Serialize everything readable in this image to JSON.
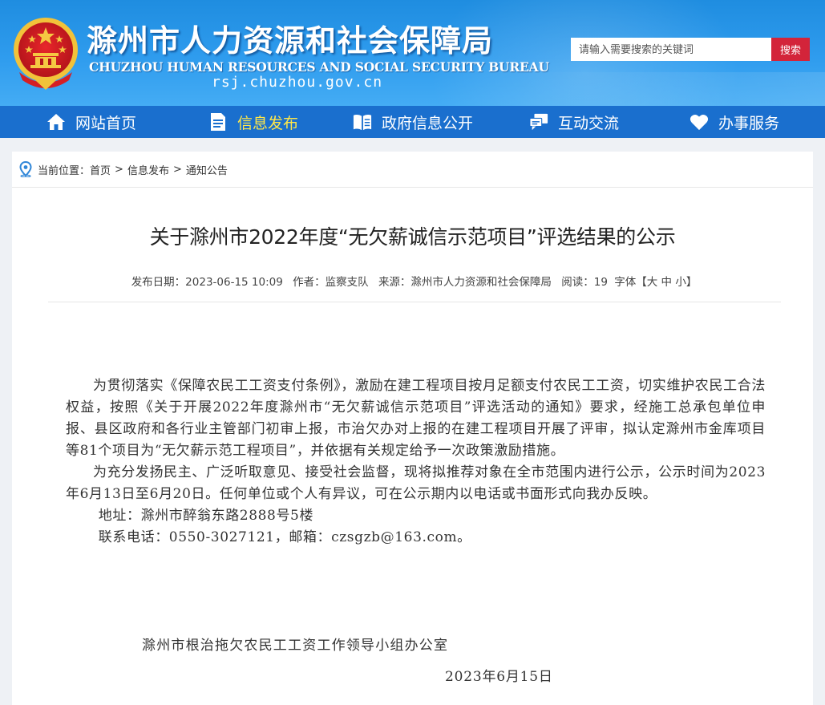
{
  "header": {
    "title": "滁州市人力资源和社会保障局",
    "subtitle": "CHUZHOU HUMAN RESOURCES AND SOCIAL SECURITY BUREAU",
    "domain": "rsj.chuzhou.gov.cn",
    "search_placeholder": "请输入需要搜索的关键词",
    "search_button": "搜索",
    "emblem_icon": "national-emblem-icon"
  },
  "nav": {
    "items": [
      {
        "label": "网站首页",
        "icon": "home-icon",
        "active": false
      },
      {
        "label": "信息发布",
        "icon": "document-icon",
        "active": true
      },
      {
        "label": "政府信息公开",
        "icon": "book-icon",
        "active": false
      },
      {
        "label": "互动交流",
        "icon": "chat-icon",
        "active": false
      },
      {
        "label": "办事服务",
        "icon": "heart-hand-icon",
        "active": false
      }
    ]
  },
  "breadcrumb": {
    "prefix": "当前位置：",
    "items": [
      "首页",
      "信息发布",
      "通知公告"
    ],
    "separator": ">"
  },
  "article": {
    "title": "关于滁州市2022年度“无欠薪诚信示范项目”评选结果的公示",
    "meta": {
      "date": "发布日期：2023-06-15 10:09",
      "author": "作者：监察支队",
      "source": "来源：滁州市人力资源和社会保障局",
      "views": "阅读：19",
      "fontsize_label": "字体【",
      "font_large": "大",
      "font_medium": "中",
      "font_small": "小",
      "fontsize_end": "】"
    },
    "paragraphs": [
      "为贯彻落实《保障农民工工资支付条例》，激励在建工程项目按月足额支付农民工工资，切实维护农民工合法权益，按照《关于开展2022年度滁州市“无欠薪诚信示范项目”评选活动的通知》要求，经施工总承包单位申报、县区政府和各行业主管部门初审上报，市治欠办对上报的在建工程项目开展了评审，拟认定滁州市金库项目等81个项目为“无欠薪示范工程项目”，并依据有关规定给予一次政策激励措施。",
      "为充分发扬民主、广泛听取意见、接受社会监督，现将拟推荐对象在全市范围内进行公示，公示时间为2023年6月13日至6月20日。任何单位或个人有异议，可在公示期内以电话或书面形式向我办反映。"
    ],
    "address": "地址：滁州市醉翁东路2888号5楼",
    "contact": "联系电话：0550-3027121，邮箱：czsgzb@163.com。",
    "signature": "滁州市根治拖欠农民工工资工作领导小组办公室",
    "sign_date": "2023年6月15日"
  },
  "colors": {
    "header_blue": "#2f9cee",
    "nav_blue": "#1a6fce",
    "nav_active": "#ffe74a",
    "search_red": "#d3243a"
  }
}
